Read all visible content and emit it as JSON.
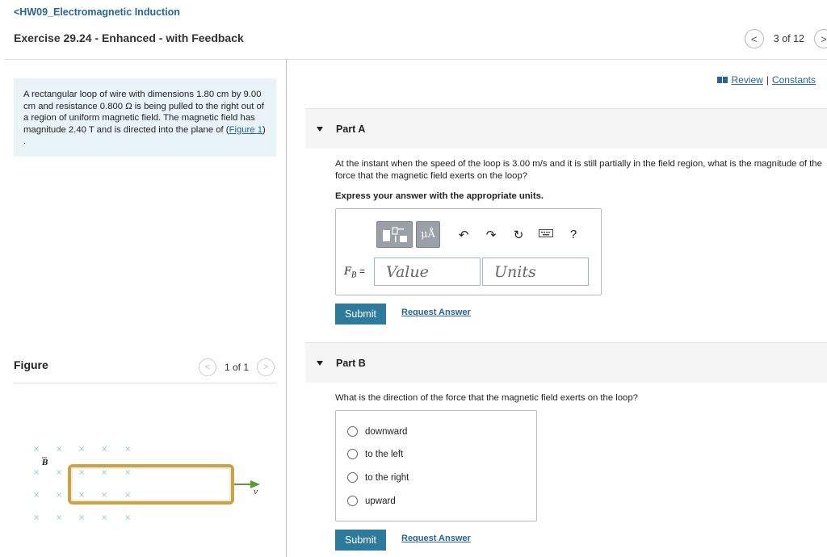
{
  "header": {
    "assignment_link": "<HW09_Electromagnetic Induction",
    "exercise_title": "Exercise 29.24 - Enhanced - with Feedback",
    "pager_prev": "<",
    "pager_count": "3 of 12",
    "pager_next": ">"
  },
  "problem": {
    "text_part1": "A rectangular loop of wire with dimensions 1.80 cm by 9.00 cm and resistance 0.800 Ω is being pulled to the right out of a region of uniform magnetic field. The magnetic field has magnitude 2.40 T and is directed into the plane of (",
    "figure_link": "Figure 1",
    "text_part2": ") ."
  },
  "figure": {
    "label": "Figure",
    "pager_prev": "<",
    "count": "1 of 1",
    "pager_next": ">",
    "field_label": "B",
    "velocity_label": "v",
    "field_mark": "×",
    "colors": {
      "field_x": "#8fc8e0",
      "loop": "#c9a24a",
      "arrow": "#5a9a3a"
    }
  },
  "review": {
    "review_label": "Review",
    "separator": "|",
    "constants_label": "Constants"
  },
  "partA": {
    "title": "Part A",
    "question": "At the instant when the speed of the loop is 3.00 m/s and it is still partially in the field region, what is the magnitude of the force that the magnetic field exerts on the loop?",
    "instruction": "Express your answer with the appropriate units.",
    "toolbar": {
      "units_button": "μÅ",
      "undo_icon": "↶",
      "redo_icon": "↷",
      "reset_icon": "↻",
      "keyboard_icon": "keyboard",
      "help": "?"
    },
    "variable_main": "F",
    "variable_sub": "B",
    "variable_eq": " =",
    "value_placeholder": "Value",
    "units_placeholder": "Units",
    "submit_label": "Submit",
    "request_answer_label": "Request Answer"
  },
  "partB": {
    "title": "Part B",
    "question": "What is the direction of the force that the magnetic field exerts on the loop?",
    "options": [
      "downward",
      "to the left",
      "to the right",
      "upward"
    ],
    "submit_label": "Submit",
    "request_answer_label": "Request Answer"
  }
}
